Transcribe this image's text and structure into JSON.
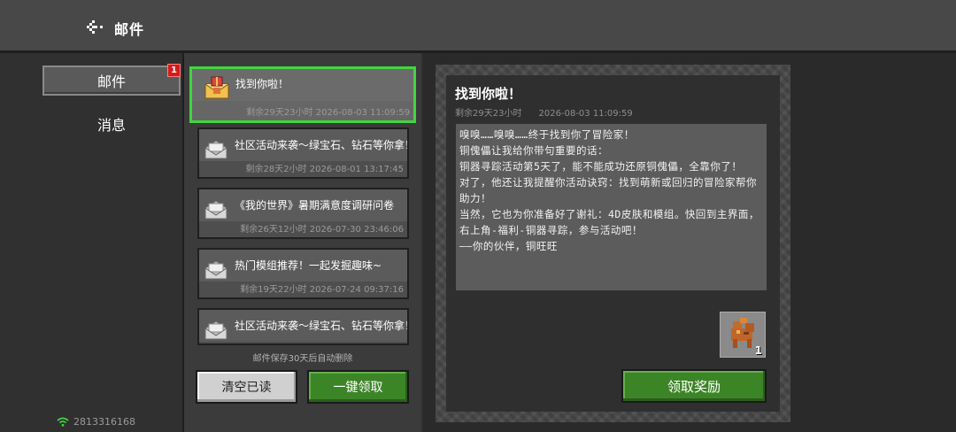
{
  "header": {
    "title": "邮件",
    "back_icon": "pixel-back-arrow-icon"
  },
  "nav": {
    "items": [
      {
        "label": "邮件",
        "badge": "1",
        "active": true
      },
      {
        "label": "消息",
        "active": false
      }
    ],
    "network_id": "2813316168",
    "wifi_color": "#3fd63f"
  },
  "mail_list": {
    "items": [
      {
        "title": "找到你啦！",
        "time": "剩余29天23小时  2026-08-03 11:09:59",
        "selected": true,
        "icon": "gift-envelope-icon"
      },
      {
        "title": "社区活动来袭～绿宝石、钻石等你拿！",
        "time": "剩余28天2小时  2026-08-01 13:17:45",
        "icon": "opened-envelope-icon"
      },
      {
        "title": "《我的世界》暑期满意度调研问卷",
        "time": "剩余26天12小时 2026-07-30 23:46:06",
        "icon": "opened-envelope-icon"
      },
      {
        "title": "热门模组推荐！一起发掘趣味~",
        "time": "剩余19天22小时 2026-07-24 09:37:16",
        "icon": "opened-envelope-icon"
      },
      {
        "title": "社区活动来袭～绿宝石、钻石等你拿！",
        "time": "",
        "icon": "opened-envelope-icon"
      }
    ],
    "hint": "邮件保存30天后自动删除",
    "clear_read_label": "清空已读",
    "claim_all_label": "一键领取"
  },
  "detail": {
    "title": "找到你啦！",
    "remaining": "剩余29天23小时",
    "date": "2026-08-03 11:09:59",
    "body": [
      "嗅嗅……嗅嗅……终于找到你了冒险家！",
      "铜傀儡让我给你带句重要的话：",
      "铜器寻踪活动第5天了，能不能成功还原铜傀儡，全靠你了！",
      "对了，他还让我提醒你活动诀窍：找到萌新或回归的冒险家帮你助力！",
      "当然，它也为你准备好了谢礼：4D皮肤和模组。快回到主界面，右上角-福利-铜器寻踪，参与活动吧！",
      "——你的伙伴，铜旺旺"
    ],
    "reward": {
      "icon": "copper-dog-reward-icon",
      "count": "1"
    },
    "claim_label": "领取奖励"
  },
  "colors": {
    "accent_green": "#3c8527",
    "selected_border": "#3fd63f",
    "badge_red": "#d51b1b"
  }
}
